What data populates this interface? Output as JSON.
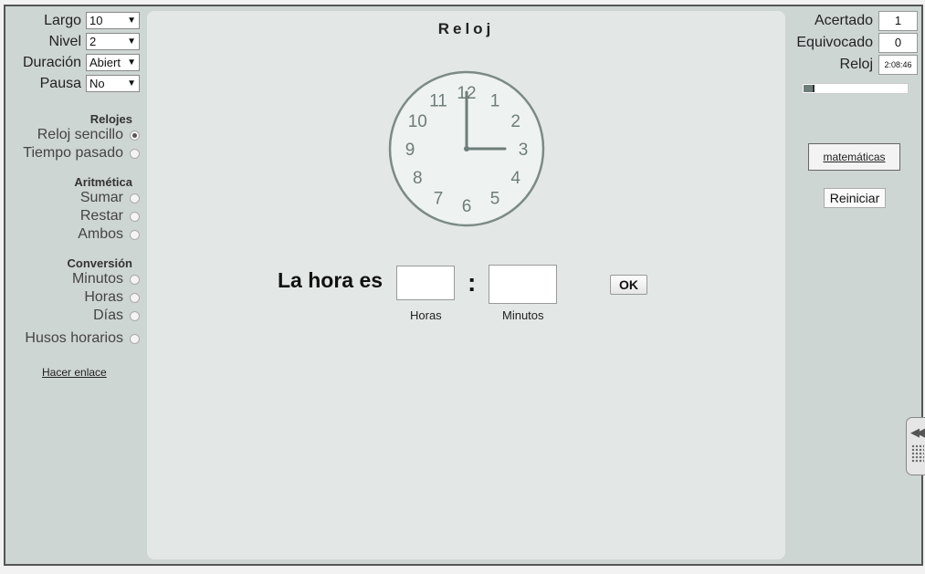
{
  "settings": [
    {
      "label": "Largo",
      "value": "10"
    },
    {
      "label": "Nivel",
      "value": "2"
    },
    {
      "label": "Duración",
      "value": "Abiert"
    },
    {
      "label": "Pausa",
      "value": "No"
    }
  ],
  "groups": {
    "clocks": {
      "title": "Relojes",
      "options": [
        {
          "label": "Reloj sencillo",
          "selected": true
        },
        {
          "label": "Tiempo pasado",
          "selected": false
        }
      ]
    },
    "arithmetic": {
      "title": "Aritmética",
      "options": [
        {
          "label": "Sumar",
          "selected": false
        },
        {
          "label": "Restar",
          "selected": false
        },
        {
          "label": "Ambos",
          "selected": false
        }
      ]
    },
    "conversion": {
      "title": "Conversión",
      "options": [
        {
          "label": "Minutos",
          "selected": false
        },
        {
          "label": "Horas",
          "selected": false
        },
        {
          "label": "Días",
          "selected": false
        }
      ]
    },
    "timezones": {
      "label": "Husos horarios",
      "selected": false
    }
  },
  "make_link": "Hacer enlace",
  "main": {
    "title": "Reloj",
    "clock": {
      "hour": 3,
      "minute": 0,
      "numbers": [
        "12",
        "1",
        "2",
        "3",
        "4",
        "5",
        "6",
        "7",
        "8",
        "9",
        "10",
        "11"
      ]
    },
    "answer_label": "La hora es",
    "colon": ":",
    "hours_label": "Horas",
    "minutes_label": "Minutos",
    "ok_label": "OK"
  },
  "stats": {
    "correct_label": "Acertado",
    "correct_value": "1",
    "wrong_label": "Equivocado",
    "wrong_value": "0",
    "timer_label": "Reloj",
    "timer_value": "2:08:46",
    "progress_fraction": 0.1
  },
  "buttons": {
    "math": "matemáticas",
    "restart": "Reiniciar"
  },
  "colors": {
    "frame": "#ced6d4",
    "panel": "#e3e8e6",
    "clock_face": "#eef2f0",
    "clock_rim": "#7c8a86",
    "hand": "#6e7d7a"
  }
}
